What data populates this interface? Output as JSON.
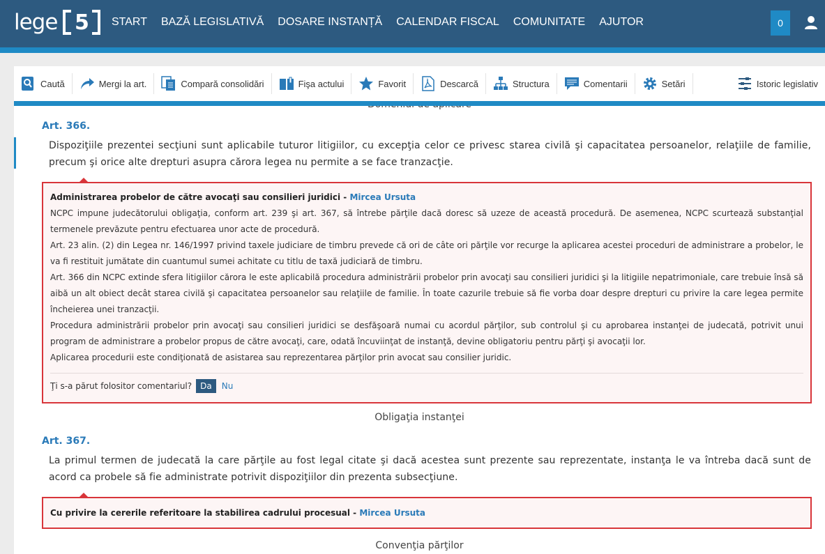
{
  "header": {
    "logo_text": "lege",
    "logo_number": "5",
    "nav": [
      "START",
      "BAZĂ LEGISLATIVĂ",
      "DOSARE INSTANȚĂ",
      "CALENDAR FISCAL",
      "COMUNITATE",
      "AJUTOR"
    ],
    "cart_count": "0"
  },
  "toolbar": {
    "items": [
      {
        "label": "Caută",
        "icon": "search-icon"
      },
      {
        "label": "Mergi la art.",
        "icon": "arrow-icon"
      },
      {
        "label": "Compară consolidări",
        "icon": "compare-icon"
      },
      {
        "label": "Fişa actului",
        "icon": "book-icon"
      },
      {
        "label": "Favorit",
        "icon": "star-icon"
      },
      {
        "label": "Descarcă",
        "icon": "pdf-icon"
      },
      {
        "label": "Structura",
        "icon": "tree-icon"
      },
      {
        "label": "Comentarii",
        "icon": "comment-icon"
      },
      {
        "label": "Setări",
        "icon": "gear-icon"
      },
      {
        "label": "Istoric legislativ",
        "icon": "history-icon"
      }
    ]
  },
  "content": {
    "section_top": "Domeniul de aplicare",
    "art366": {
      "title": "Art. 366.",
      "text": "Dispoziţiile prezentei secţiuni sunt aplicabile tuturor litigiilor, cu excepţia celor ce privesc starea civilă şi capacitatea persoanelor, relaţiile de familie, precum şi orice alte drepturi asupra cărora legea nu permite a se face tranzacţie."
    },
    "comment1": {
      "title": "Administrarea probelor de către avocaţi sau consilieri juridici",
      "separator": " - ",
      "author": "Mircea Ursuta",
      "paragraphs": [
        "NCPC impune judecătorului obligaţia, conform art. 239 şi art. 367, să întrebe părţile dacă doresc să uzeze de această procedură. De asemenea, NCPC scurtează substanţial termenele prevăzute pentru efectuarea unor acte de procedură.",
        "Art. 23 alin. (2) din Legea nr. 146/1997 privind taxele judiciare de timbru prevede că ori de câte ori părţile vor recurge la aplicarea acestei proceduri de administrare a probelor, le va fi restituit jumătate din cuantumul sumei achitate cu titlu de taxă judiciară de timbru.",
        "Art. 366 din NCPC extinde sfera litigiilor cărora le este aplicabilă procedura administrării probelor prin avocaţi sau consilieri juridici şi la litigiile nepatrimoniale, care trebuie însă să aibă un alt obiect decât starea civilă şi capacitatea persoanelor sau relaţiile de familie. În toate cazurile trebuie să fie vorba doar despre drepturi cu privire la care legea permite încheierea unei tranzacţii.",
        "Procedura administrării probelor prin avocaţi sau consilieri juridici se desfăşoară numai cu acordul părţilor, sub controlul şi cu aprobarea instanţei de judecată, potrivit unui program de administrare a probelor propus de către avocaţi, care, odată încuviinţat de instanţă, devine obligatoriu pentru părţi şi avocaţii lor.",
        "Aplicarea procedurii este condiţionată de asistarea sau reprezentarea părţilor prin avocat sau consilier juridic."
      ],
      "feedback_question": "Ţi s-a părut folositor comentariul?",
      "yes": "Da",
      "no": "Nu"
    },
    "section_367": "Obligaţia instanţei",
    "art367": {
      "title": "Art. 367.",
      "text": "La primul termen de judecată la care părţile au fost legal citate şi dacă acestea sunt prezente sau reprezentate, instanţa le va întreba dacă sunt de acord ca probele să fie administrate potrivit dispoziţiilor din prezenta subsecţiune."
    },
    "comment2": {
      "title": "Cu privire la cererile referitoare la stabilirea cadrului procesual",
      "separator": " - ",
      "author": "Mircea Ursuta"
    },
    "section_368": "Convenţia părţilor"
  },
  "colors": {
    "header_bg": "#2d5a80",
    "accent_blue": "#1f8ac5",
    "link_blue": "#2a7ab8",
    "comment_border": "#d8353a",
    "comment_bg": "#fdf5f5"
  }
}
